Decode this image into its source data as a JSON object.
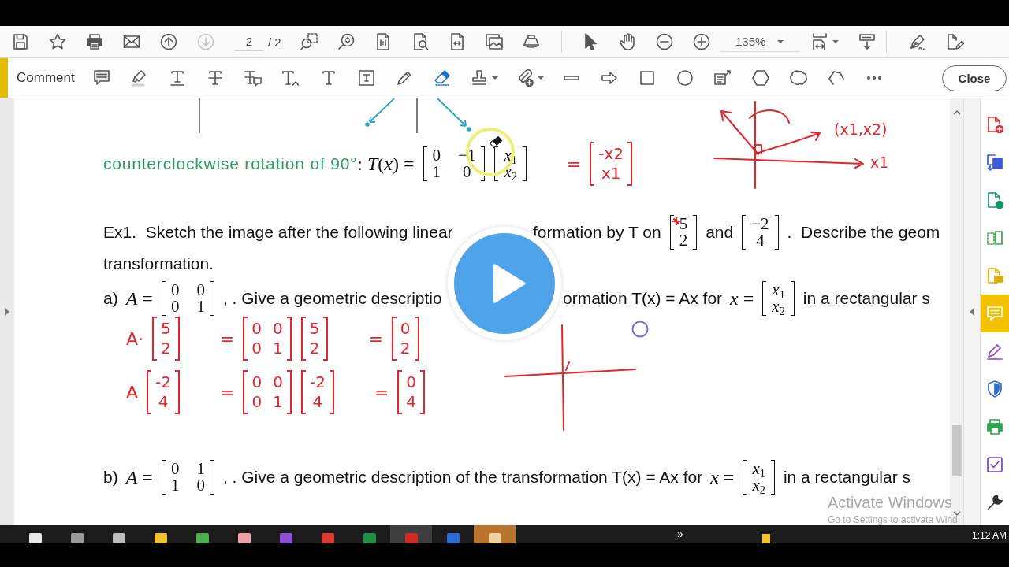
{
  "toolbar": {
    "file_tools": [
      {
        "disabled": false
      },
      {
        "disabled": false
      },
      {
        "disabled": false
      },
      {
        "disabled": false
      },
      {
        "disabled": false
      },
      {
        "disabled": true
      }
    ],
    "page_number": "2",
    "page_count": "/ 2",
    "zoom": "135%"
  },
  "comment_toolbar": {
    "title": "Comment",
    "tools": [
      {
        "selected": false
      },
      {
        "selected": false
      },
      {
        "selected": false
      },
      {
        "selected": false
      },
      {
        "selected": false
      },
      {
        "selected": false
      },
      {
        "selected": false
      },
      {
        "selected": false
      },
      {
        "selected": false
      },
      {
        "selected": true
      },
      {
        "selected": false
      },
      {
        "selected": false
      },
      {
        "selected": false
      },
      {
        "selected": false
      },
      {
        "selected": false
      },
      {
        "selected": false
      },
      {
        "selected": false
      },
      {
        "selected": false
      },
      {
        "selected": false
      },
      {
        "selected": false
      }
    ],
    "close_button": "Close"
  },
  "document": {
    "blocks": [
      {
        "kind": "line",
        "parts": [
          {
            "kind": "label",
            "text": "counterclockwise rotation of 90°"
          },
          {
            "kind": "math",
            "text": ": *T*(*x*) ="
          },
          {
            "kind": "matrix",
            "rows": [
              [
                "0",
                "−1"
              ],
              [
                "1",
                "0"
              ]
            ]
          },
          {
            "kind": "matrix",
            "rows": [
              [
                "*x*$_{1}$"
              ],
              [
                "*x*$_{2}$"
              ]
            ]
          },
          {
            "kind": "ink_text",
            "text": "="
          },
          {
            "kind": "ink_matrix",
            "rows": [
              [
                "-x2"
              ],
              [
                "x1"
              ]
            ]
          }
        ]
      },
      {
        "kind": "line",
        "parts": [
          {
            "kind": "text",
            "text": "Ex1.  Sketch the image after the following linear"
          }
        ],
        "right_parts": [
          {
            "kind": "text",
            "text": "formation by T on"
          },
          {
            "kind": "matrix",
            "rows": [
              [
                "5"
              ],
              [
                "2"
              ]
            ],
            "ink_mark": true
          },
          {
            "kind": "text",
            "text": "and"
          },
          {
            "kind": "matrix",
            "rows": [
              [
                "−2"
              ],
              [
                "4"
              ]
            ]
          },
          {
            "kind": "text",
            "text": ".  Describe the geom"
          }
        ]
      },
      {
        "kind": "line",
        "parts": [
          {
            "kind": "text",
            "text": "transformation."
          }
        ]
      },
      {
        "kind": "line",
        "parts": [
          {
            "kind": "text",
            "text": "a)"
          },
          {
            "kind": "math",
            "text": "*A* ="
          },
          {
            "kind": "matrix",
            "rows": [
              [
                "0",
                "0"
              ],
              [
                "0",
                "1"
              ]
            ]
          },
          {
            "kind": "text",
            "text": ", . Give a geometric descriptio"
          }
        ],
        "right_parts": [
          {
            "kind": "text",
            "text": "ormation T(x) = Ax for"
          },
          {
            "kind": "math",
            "text": "*x* ="
          },
          {
            "kind": "matrix",
            "rows": [
              [
                "*x*$_{1}$"
              ],
              [
                "*x*$_{2}$"
              ]
            ]
          },
          {
            "kind": "text",
            "text": "in a rectangular s"
          }
        ]
      },
      {
        "kind": "ink",
        "parts": [
          {
            "kind": "ink_text",
            "text": "A·"
          },
          {
            "kind": "ink_matrix",
            "rows": [
              [
                "5"
              ],
              [
                "2"
              ]
            ]
          },
          {
            "kind": "ink_text",
            "text": "="
          },
          {
            "kind": "ink_matrix",
            "rows": [
              [
                "0",
                "0"
              ],
              [
                "0",
                "1"
              ]
            ]
          },
          {
            "kind": "ink_matrix",
            "rows": [
              [
                "5"
              ],
              [
                "2"
              ]
            ]
          },
          {
            "kind": "ink_text",
            "text": "="
          },
          {
            "kind": "ink_matrix",
            "rows": [
              [
                "0"
              ],
              [
                "2"
              ]
            ]
          }
        ]
      },
      {
        "kind": "ink",
        "parts": [
          {
            "kind": "ink_text",
            "text": "A"
          },
          {
            "kind": "ink_matrix",
            "rows": [
              [
                "-2"
              ],
              [
                "4"
              ]
            ]
          },
          {
            "kind": "ink_text",
            "text": "="
          },
          {
            "kind": "ink_matrix",
            "rows": [
              [
                "0",
                "0"
              ],
              [
                "0",
                "1"
              ]
            ]
          },
          {
            "kind": "ink_matrix",
            "rows": [
              [
                "-2"
              ],
              [
                "4"
              ]
            ]
          },
          {
            "kind": "ink_text",
            "text": "="
          },
          {
            "kind": "ink_matrix",
            "rows": [
              [
                "0"
              ],
              [
                "4"
              ]
            ]
          }
        ]
      },
      {
        "kind": "line",
        "parts": [
          {
            "kind": "text",
            "text": "b)"
          },
          {
            "kind": "math",
            "text": "*A* ="
          },
          {
            "kind": "matrix",
            "rows": [
              [
                "0",
                "1"
              ],
              [
                "1",
                "0"
              ]
            ]
          },
          {
            "kind": "text",
            "text": ", . Give a geometric description of the transformation T(x) = Ax for"
          },
          {
            "kind": "math",
            "text": "*x* ="
          },
          {
            "kind": "matrix",
            "rows": [
              [
                "*x*$_{1}$"
              ],
              [
                "*x*$_{2}$"
              ]
            ]
          },
          {
            "kind": "text",
            "text": "in a rectangular s"
          }
        ]
      }
    ],
    "sketch_labels": [
      "(x1,x2)",
      "x1"
    ]
  },
  "tools_pane": [
    {
      "selected": false
    },
    {
      "selected": false
    },
    {
      "selected": false
    },
    {
      "selected": false
    },
    {
      "selected": false
    },
    {
      "selected": true
    },
    {
      "selected": false
    },
    {
      "selected": false
    },
    {
      "selected": false
    },
    {
      "selected": false
    },
    {
      "selected": false
    }
  ],
  "activation_notice": {
    "title": "Activate Windows",
    "subtitle": "Go to Settings to activate Wind"
  },
  "taskbar": {
    "apps": [
      {
        "active": false,
        "flashing": false
      },
      {
        "active": false,
        "flashing": false
      },
      {
        "active": false,
        "flashing": false
      },
      {
        "active": false,
        "flashing": false
      },
      {
        "active": false,
        "flashing": false
      },
      {
        "active": false,
        "flashing": false
      },
      {
        "active": false,
        "flashing": false
      },
      {
        "active": false,
        "flashing": false
      },
      {
        "active": false,
        "flashing": false
      },
      {
        "active": true,
        "flashing": false
      },
      {
        "active": false,
        "flashing": false
      },
      {
        "active": false,
        "flashing": true
      }
    ],
    "overflow": "»",
    "clock": "1:12 AM"
  }
}
